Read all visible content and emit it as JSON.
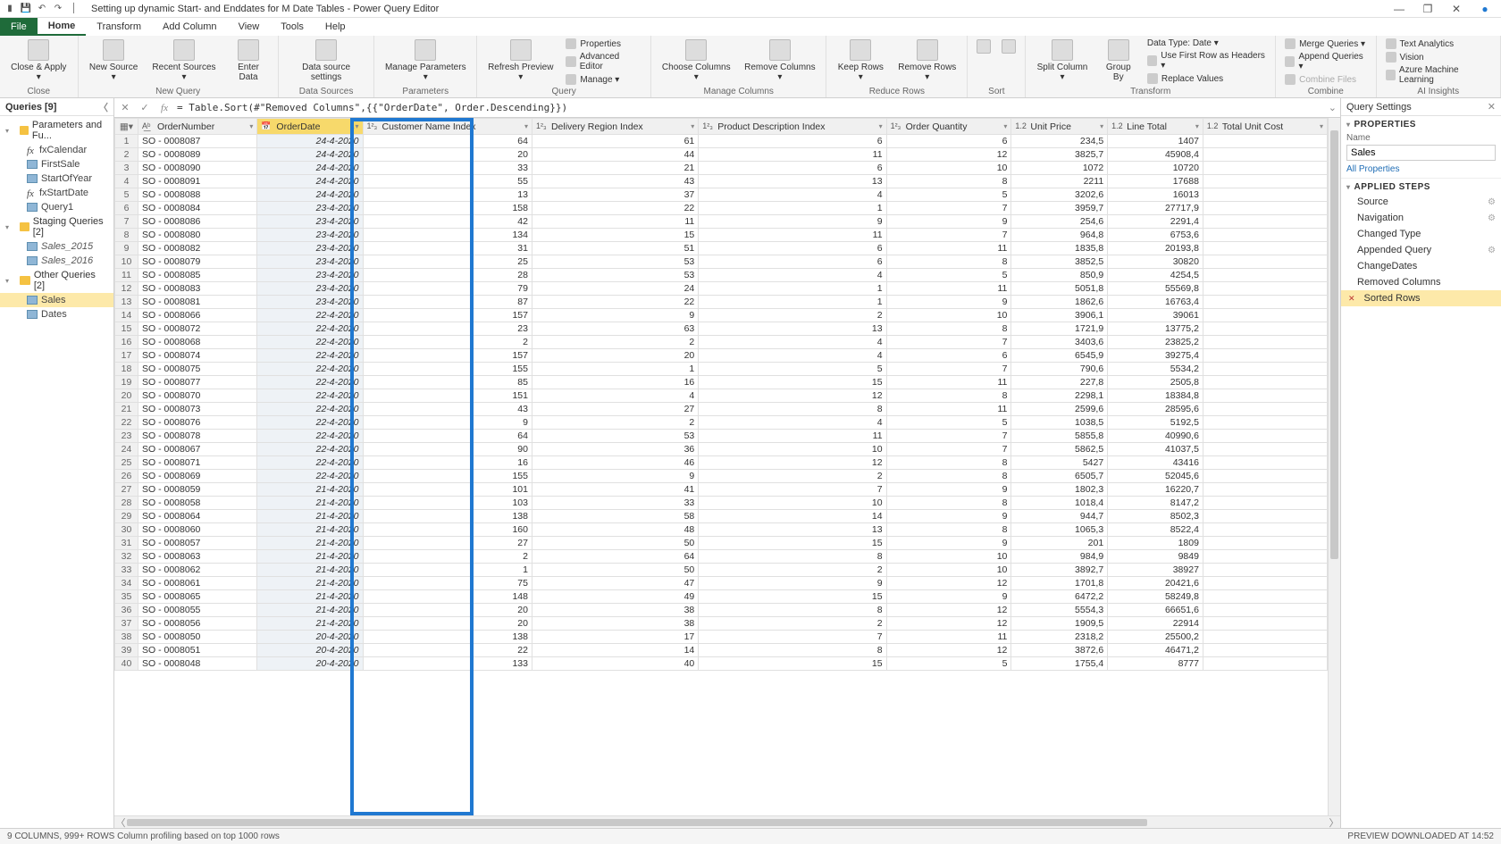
{
  "window": {
    "title": "Setting up dynamic Start- and Enddates for M Date Tables - Power Query Editor"
  },
  "menu_tabs": {
    "file": "File",
    "home": "Home",
    "transform": "Transform",
    "add_column": "Add Column",
    "view": "View",
    "tools": "Tools",
    "help": "Help"
  },
  "ribbon": {
    "close_apply": "Close &\nApply ▾",
    "new_source": "New\nSource ▾",
    "recent_sources": "Recent\nSources ▾",
    "enter_data": "Enter\nData",
    "data_source_settings": "Data source\nsettings",
    "manage_parameters": "Manage\nParameters ▾",
    "refresh_preview": "Refresh\nPreview ▾",
    "properties": "Properties",
    "advanced_editor": "Advanced Editor",
    "manage": "Manage ▾",
    "choose_columns": "Choose\nColumns ▾",
    "remove_columns": "Remove\nColumns ▾",
    "keep_rows": "Keep\nRows ▾",
    "remove_rows": "Remove\nRows ▾",
    "sort": "",
    "split_column": "Split\nColumn ▾",
    "group_by": "Group\nBy",
    "data_type": "Data Type: Date ▾",
    "first_row_headers": "Use First Row as Headers ▾",
    "replace_values": "Replace Values",
    "merge_queries": "Merge Queries ▾",
    "append_queries": "Append Queries ▾",
    "combine_files": "Combine Files",
    "text_analytics": "Text Analytics",
    "vision": "Vision",
    "azure_ml": "Azure Machine Learning",
    "grp_close": "Close",
    "grp_new_query": "New Query",
    "grp_data_sources": "Data Sources",
    "grp_parameters": "Parameters",
    "grp_query": "Query",
    "grp_manage_columns": "Manage Columns",
    "grp_reduce_rows": "Reduce Rows",
    "grp_sort": "Sort",
    "grp_transform": "Transform",
    "grp_combine": "Combine",
    "grp_ai": "AI Insights"
  },
  "queries_pane": {
    "header": "Queries [9]",
    "groups": [
      {
        "name": "Parameters and Fu...",
        "items": [
          {
            "label": "fxCalendar",
            "type": "fx"
          },
          {
            "label": "FirstSale",
            "type": "q"
          },
          {
            "label": "StartOfYear",
            "type": "q"
          },
          {
            "label": "fxStartDate",
            "type": "fx"
          },
          {
            "label": "Query1",
            "type": "q"
          }
        ]
      },
      {
        "name": "Staging Queries [2]",
        "items": [
          {
            "label": "Sales_2015",
            "type": "q",
            "italic": true
          },
          {
            "label": "Sales_2016",
            "type": "q",
            "italic": true
          }
        ]
      },
      {
        "name": "Other Queries [2]",
        "items": [
          {
            "label": "Sales",
            "type": "q",
            "selected": true
          },
          {
            "label": "Dates",
            "type": "q"
          }
        ]
      }
    ]
  },
  "formula": "= Table.Sort(#\"Removed Columns\",{{\"OrderDate\", Order.Descending}})",
  "columns": [
    {
      "name": "OrderNumber",
      "icon": "A͟ᵇ"
    },
    {
      "name": "OrderDate",
      "icon": "📅",
      "selected": true,
      "dd": "↓▾"
    },
    {
      "name": "Customer Name Index",
      "icon": "1²₃"
    },
    {
      "name": "Delivery Region Index",
      "icon": "1²₃"
    },
    {
      "name": "Product Description Index",
      "icon": "1²₃"
    },
    {
      "name": "Order Quantity",
      "icon": "1²₃"
    },
    {
      "name": "Unit Price",
      "icon": "1.2"
    },
    {
      "name": "Line Total",
      "icon": "1.2"
    },
    {
      "name": "Total Unit Cost",
      "icon": "1.2"
    }
  ],
  "rows": [
    [
      "SO - 0008087",
      "24-4-2020",
      "64",
      "61",
      "6",
      "6",
      "234,5",
      "1407",
      ""
    ],
    [
      "SO - 0008089",
      "24-4-2020",
      "20",
      "44",
      "11",
      "12",
      "3825,7",
      "45908,4",
      ""
    ],
    [
      "SO - 0008090",
      "24-4-2020",
      "33",
      "21",
      "6",
      "10",
      "1072",
      "10720",
      ""
    ],
    [
      "SO - 0008091",
      "24-4-2020",
      "55",
      "43",
      "13",
      "8",
      "2211",
      "17688",
      ""
    ],
    [
      "SO - 0008088",
      "24-4-2020",
      "13",
      "37",
      "4",
      "5",
      "3202,6",
      "16013",
      ""
    ],
    [
      "SO - 0008084",
      "23-4-2020",
      "158",
      "22",
      "1",
      "7",
      "3959,7",
      "27717,9",
      ""
    ],
    [
      "SO - 0008086",
      "23-4-2020",
      "42",
      "11",
      "9",
      "9",
      "254,6",
      "2291,4",
      ""
    ],
    [
      "SO - 0008080",
      "23-4-2020",
      "134",
      "15",
      "11",
      "7",
      "964,8",
      "6753,6",
      ""
    ],
    [
      "SO - 0008082",
      "23-4-2020",
      "31",
      "51",
      "6",
      "11",
      "1835,8",
      "20193,8",
      ""
    ],
    [
      "SO - 0008079",
      "23-4-2020",
      "25",
      "53",
      "6",
      "8",
      "3852,5",
      "30820",
      ""
    ],
    [
      "SO - 0008085",
      "23-4-2020",
      "28",
      "53",
      "4",
      "5",
      "850,9",
      "4254,5",
      ""
    ],
    [
      "SO - 0008083",
      "23-4-2020",
      "79",
      "24",
      "1",
      "11",
      "5051,8",
      "55569,8",
      ""
    ],
    [
      "SO - 0008081",
      "23-4-2020",
      "87",
      "22",
      "1",
      "9",
      "1862,6",
      "16763,4",
      ""
    ],
    [
      "SO - 0008066",
      "22-4-2020",
      "157",
      "9",
      "2",
      "10",
      "3906,1",
      "39061",
      ""
    ],
    [
      "SO - 0008072",
      "22-4-2020",
      "23",
      "63",
      "13",
      "8",
      "1721,9",
      "13775,2",
      ""
    ],
    [
      "SO - 0008068",
      "22-4-2020",
      "2",
      "2",
      "4",
      "7",
      "3403,6",
      "23825,2",
      ""
    ],
    [
      "SO - 0008074",
      "22-4-2020",
      "157",
      "20",
      "4",
      "6",
      "6545,9",
      "39275,4",
      ""
    ],
    [
      "SO - 0008075",
      "22-4-2020",
      "155",
      "1",
      "5",
      "7",
      "790,6",
      "5534,2",
      ""
    ],
    [
      "SO - 0008077",
      "22-4-2020",
      "85",
      "16",
      "15",
      "11",
      "227,8",
      "2505,8",
      ""
    ],
    [
      "SO - 0008070",
      "22-4-2020",
      "151",
      "4",
      "12",
      "8",
      "2298,1",
      "18384,8",
      ""
    ],
    [
      "SO - 0008073",
      "22-4-2020",
      "43",
      "27",
      "8",
      "11",
      "2599,6",
      "28595,6",
      ""
    ],
    [
      "SO - 0008076",
      "22-4-2020",
      "9",
      "2",
      "4",
      "5",
      "1038,5",
      "5192,5",
      ""
    ],
    [
      "SO - 0008078",
      "22-4-2020",
      "64",
      "53",
      "11",
      "7",
      "5855,8",
      "40990,6",
      ""
    ],
    [
      "SO - 0008067",
      "22-4-2020",
      "90",
      "36",
      "10",
      "7",
      "5862,5",
      "41037,5",
      ""
    ],
    [
      "SO - 0008071",
      "22-4-2020",
      "16",
      "46",
      "12",
      "8",
      "5427",
      "43416",
      ""
    ],
    [
      "SO - 0008069",
      "22-4-2020",
      "155",
      "9",
      "2",
      "8",
      "6505,7",
      "52045,6",
      ""
    ],
    [
      "SO - 0008059",
      "21-4-2020",
      "101",
      "41",
      "7",
      "9",
      "1802,3",
      "16220,7",
      ""
    ],
    [
      "SO - 0008058",
      "21-4-2020",
      "103",
      "33",
      "10",
      "8",
      "1018,4",
      "8147,2",
      ""
    ],
    [
      "SO - 0008064",
      "21-4-2020",
      "138",
      "58",
      "14",
      "9",
      "944,7",
      "8502,3",
      ""
    ],
    [
      "SO - 0008060",
      "21-4-2020",
      "160",
      "48",
      "13",
      "8",
      "1065,3",
      "8522,4",
      ""
    ],
    [
      "SO - 0008057",
      "21-4-2020",
      "27",
      "50",
      "15",
      "9",
      "201",
      "1809",
      ""
    ],
    [
      "SO - 0008063",
      "21-4-2020",
      "2",
      "64",
      "8",
      "10",
      "984,9",
      "9849",
      ""
    ],
    [
      "SO - 0008062",
      "21-4-2020",
      "1",
      "50",
      "2",
      "10",
      "3892,7",
      "38927",
      ""
    ],
    [
      "SO - 0008061",
      "21-4-2020",
      "75",
      "47",
      "9",
      "12",
      "1701,8",
      "20421,6",
      ""
    ],
    [
      "SO - 0008065",
      "21-4-2020",
      "148",
      "49",
      "15",
      "9",
      "6472,2",
      "58249,8",
      ""
    ],
    [
      "SO - 0008055",
      "21-4-2020",
      "20",
      "38",
      "8",
      "12",
      "5554,3",
      "66651,6",
      ""
    ],
    [
      "SO - 0008056",
      "21-4-2020",
      "20",
      "38",
      "2",
      "12",
      "1909,5",
      "22914",
      ""
    ],
    [
      "SO - 0008050",
      "20-4-2020",
      "138",
      "17",
      "7",
      "11",
      "2318,2",
      "25500,2",
      ""
    ],
    [
      "SO - 0008051",
      "20-4-2020",
      "22",
      "14",
      "8",
      "12",
      "3872,6",
      "46471,2",
      ""
    ],
    [
      "SO - 0008048",
      "20-4-2020",
      "133",
      "40",
      "15",
      "5",
      "1755,4",
      "8777",
      ""
    ]
  ],
  "settings": {
    "header": "Query Settings",
    "properties": "PROPERTIES",
    "name_label": "Name",
    "name_value": "Sales",
    "all_properties": "All Properties",
    "applied_steps": "APPLIED STEPS",
    "steps": [
      {
        "label": "Source",
        "gear": true
      },
      {
        "label": "Navigation",
        "gear": true
      },
      {
        "label": "Changed Type"
      },
      {
        "label": "Appended Query",
        "gear": true
      },
      {
        "label": "ChangeDates"
      },
      {
        "label": "Removed Columns"
      },
      {
        "label": "Sorted Rows",
        "selected": true
      }
    ]
  },
  "status": {
    "left": "9 COLUMNS, 999+ ROWS    Column profiling based on top 1000 rows",
    "right": "PREVIEW DOWNLOADED AT 14:52"
  }
}
